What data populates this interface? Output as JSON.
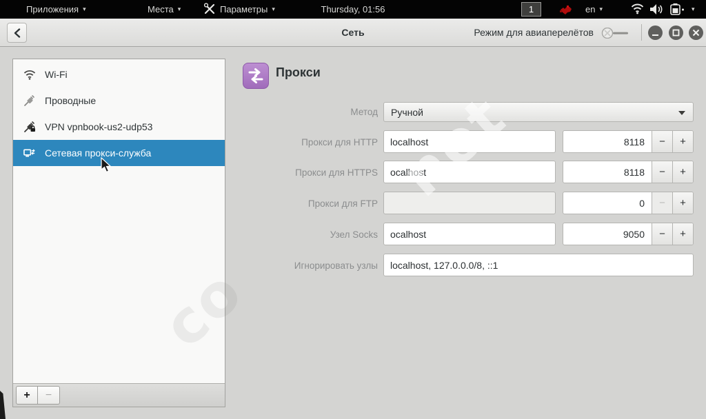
{
  "topbar": {
    "applications_label": "Приложения",
    "places_label": "Места",
    "settings_label": "Параметры",
    "clock": "Thursday, 01:56",
    "workspace": "1",
    "keyboard_layout": "en"
  },
  "icons": {
    "caret": "▾"
  },
  "ui": {
    "minus": "−",
    "plus": "+"
  },
  "headerbar": {
    "title": "Сеть",
    "airplane_label": "Режим для авиаперелётов"
  },
  "sidebar": {
    "items": [
      {
        "label": "Wi-Fi",
        "icon": "wifi"
      },
      {
        "label": "Проводные",
        "icon": "wired"
      },
      {
        "label": "VPN vpnbook-us2-udp53",
        "icon": "vpn"
      },
      {
        "label": "Сетевая прокси-служба",
        "icon": "network-proxy",
        "selected": true
      }
    ],
    "add_label": "+",
    "remove_label": "−"
  },
  "main": {
    "title": "Прокси",
    "rows": [
      {
        "label": "Метод",
        "type": "dropdown",
        "value": "Ручной"
      },
      {
        "label": "Прокси для HTTP",
        "type": "host-port",
        "host": "localhost",
        "port": "8118"
      },
      {
        "label": "Прокси для HTTPS",
        "type": "host-port",
        "host": "ocalhost",
        "port": "8118"
      },
      {
        "label": "Прокси для FTP",
        "type": "host-port",
        "host": "",
        "port": "0",
        "minus_disabled": true
      },
      {
        "label": "Узел Socks",
        "type": "host-port",
        "host": "ocalhost",
        "port": "9050"
      },
      {
        "label": "Игнорировать узлы",
        "type": "text",
        "value": "localhost, 127.0.0.0/8, ::1"
      }
    ]
  },
  "watermark": {
    "left": "co",
    "right": "net"
  },
  "colors": {
    "selection": "#2d87bd",
    "proxy_icon": "#ad7fc4",
    "panel": "#040404"
  }
}
